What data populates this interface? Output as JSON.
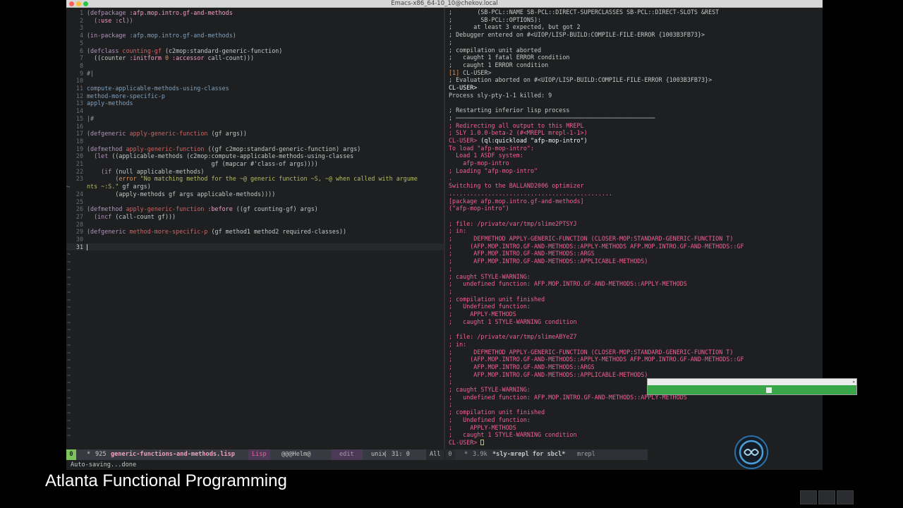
{
  "window": {
    "title": "Emacs-x86_64-10_10@chekov.local"
  },
  "colors": {
    "keyword": "#b294bb",
    "name": "#cc6666",
    "symbol": "#f0a0c0",
    "string": "#b5bd68",
    "function": "#81a2be",
    "paren": "#9da3a8",
    "builtin": "#de935f",
    "comment": "#969896",
    "repl_prompt": "#f5f5f5",
    "repl_output": "#f06292",
    "text": "#c5c8c6"
  },
  "editor": {
    "lines": [
      {
        "n": "1",
        "segs": [
          [
            "(",
            "paren"
          ],
          [
            "defpackage",
            "keyword"
          ],
          [
            " :afp.mop.intro.gf-and-methods",
            "symbol"
          ]
        ]
      },
      {
        "n": "2",
        "segs": [
          [
            "  (",
            "paren"
          ],
          [
            ":use :cl",
            "symbol"
          ],
          [
            "))",
            "paren"
          ]
        ]
      },
      {
        "n": "3",
        "segs": []
      },
      {
        "n": "4",
        "segs": [
          [
            "(",
            "paren"
          ],
          [
            "in-package",
            "keyword"
          ],
          [
            " :afp.mop.intro.gf-and-methods",
            "function"
          ],
          [
            ")",
            "paren"
          ]
        ]
      },
      {
        "n": "5",
        "segs": []
      },
      {
        "n": "6",
        "segs": [
          [
            "(",
            "paren"
          ],
          [
            "defclass",
            "keyword"
          ],
          [
            " counting-gf",
            "name"
          ],
          [
            " (c2mop:standard-generic-function)",
            "text"
          ]
        ]
      },
      {
        "n": "7",
        "segs": [
          [
            "  ((counter ",
            "text"
          ],
          [
            ":initform",
            "symbol"
          ],
          [
            " 0 ",
            "builtin"
          ],
          [
            ":accessor",
            "symbol"
          ],
          [
            " call-count)))",
            "text"
          ]
        ]
      },
      {
        "n": "8",
        "segs": []
      },
      {
        "n": "9",
        "segs": [
          [
            "#|",
            "comment"
          ]
        ]
      },
      {
        "n": "10",
        "segs": []
      },
      {
        "n": "11",
        "segs": [
          [
            "compute-applicable-methods-using-classes",
            "function"
          ]
        ]
      },
      {
        "n": "12",
        "segs": [
          [
            "method-more-specific-p",
            "function"
          ]
        ]
      },
      {
        "n": "13",
        "segs": [
          [
            "apply-methods",
            "function"
          ]
        ]
      },
      {
        "n": "14",
        "segs": []
      },
      {
        "n": "15",
        "segs": [
          [
            "|#",
            "comment"
          ]
        ]
      },
      {
        "n": "16",
        "segs": []
      },
      {
        "n": "17",
        "segs": [
          [
            "(",
            "paren"
          ],
          [
            "defgeneric",
            "keyword"
          ],
          [
            " apply-generic-function",
            "name"
          ],
          [
            " (gf args))",
            "text"
          ]
        ]
      },
      {
        "n": "18",
        "segs": []
      },
      {
        "n": "19",
        "segs": [
          [
            "(",
            "paren"
          ],
          [
            "defmethod",
            "keyword"
          ],
          [
            " apply-generic-function",
            "name"
          ],
          [
            " ((gf c2mop:standard-generic-function) args)",
            "text"
          ]
        ]
      },
      {
        "n": "20",
        "segs": [
          [
            "  (",
            "paren"
          ],
          [
            "let",
            "keyword"
          ],
          [
            " ((applicable-methods (c2mop:compute-applicable-methods-using-classes",
            "text"
          ]
        ]
      },
      {
        "n": "21",
        "segs": [
          [
            "                                   gf (mapcar #'class-of args))))",
            "text"
          ]
        ]
      },
      {
        "n": "22",
        "segs": [
          [
            "    (",
            "paren"
          ],
          [
            "if",
            "keyword"
          ],
          [
            " (null applicable-methods)",
            "text"
          ]
        ]
      },
      {
        "n": "23",
        "segs": [
          [
            "        (",
            "paren"
          ],
          [
            "error",
            "builtin"
          ],
          [
            " \"No matching method for the ~@ generic function ~S, ~@ when called with argume",
            "string"
          ]
        ]
      },
      {
        "n": "",
        "wrap": true,
        "segs": [
          [
            "nts ~:S.\"",
            "string"
          ],
          [
            " gf args)",
            "text"
          ]
        ]
      },
      {
        "n": "24",
        "segs": [
          [
            "        (apply-methods gf args applicable-methods))))",
            "text"
          ]
        ]
      },
      {
        "n": "25",
        "segs": []
      },
      {
        "n": "26",
        "segs": [
          [
            "(",
            "paren"
          ],
          [
            "defmethod",
            "keyword"
          ],
          [
            " apply-generic-function",
            "name"
          ],
          [
            " :before",
            "symbol"
          ],
          [
            " ((gf counting-gf) args)",
            "text"
          ]
        ]
      },
      {
        "n": "27",
        "segs": [
          [
            "  (",
            "paren"
          ],
          [
            "incf",
            "keyword"
          ],
          [
            " (call-count gf)))",
            "text"
          ]
        ]
      },
      {
        "n": "28",
        "segs": []
      },
      {
        "n": "29",
        "segs": [
          [
            "(",
            "paren"
          ],
          [
            "defgeneric",
            "keyword"
          ],
          [
            " method-more-specific-p",
            "name"
          ],
          [
            " (gf method1 method2 required-classes))",
            "text"
          ]
        ]
      },
      {
        "n": "30",
        "segs": []
      },
      {
        "n": "31",
        "segs": [],
        "cursor": true
      }
    ],
    "tilde_count": 25,
    "tilde_char": "~"
  },
  "repl": {
    "lines": [
      {
        "segs": [
          [
            ";       (SB-PCL::NAME SB-PCL::DIRECT-SUPERCLASSES SB-PCL::DIRECT-SLOTS &REST",
            "text"
          ]
        ]
      },
      {
        "segs": [
          [
            ";        SB-PCL::OPTIONS):",
            "text"
          ]
        ]
      },
      {
        "segs": [
          [
            ";      at least 3 expected, but got 2",
            "text"
          ]
        ]
      },
      {
        "segs": [
          [
            "; Debugger entered on #<UIOP/LISP-BUILD:COMPILE-FILE-ERROR {1003B3FB73}>",
            "text"
          ]
        ]
      },
      {
        "segs": [
          [
            ";",
            "text"
          ]
        ]
      },
      {
        "segs": [
          [
            "; compilation unit aborted",
            "text"
          ]
        ]
      },
      {
        "segs": [
          [
            ";   caught 1 fatal ERROR condition",
            "text"
          ]
        ]
      },
      {
        "segs": [
          [
            ";   caught 1 ERROR condition",
            "text"
          ]
        ]
      },
      {
        "segs": [
          [
            "[1] ",
            "builtin"
          ],
          [
            "CL-USER>",
            "text"
          ]
        ]
      },
      {
        "segs": [
          [
            "; Evaluation aborted on #<UIOP/LISP-BUILD:COMPILE-FILE-ERROR {1003B3FB73}>",
            "text"
          ]
        ]
      },
      {
        "segs": [
          [
            "CL-USER>",
            "repl_prompt"
          ]
        ]
      },
      {
        "segs": [
          [
            "Process sly-pty-1-1 killed: 9",
            "text"
          ]
        ]
      },
      {
        "segs": []
      },
      {
        "segs": [
          [
            "; Restarting inferior lisp process",
            "text"
          ]
        ]
      },
      {
        "segs": [
          [
            "; ────────────────────────────────────────────────────────",
            "text"
          ]
        ]
      },
      {
        "segs": [
          [
            "; Redirecting all output to this MREPL",
            "repl_output"
          ]
        ]
      },
      {
        "segs": [
          [
            "; SLY 1.0.0-beta-2 (#<MREPL mrepl-1-1>)",
            "repl_output"
          ]
        ]
      },
      {
        "segs": [
          [
            "CL-USER> ",
            "repl_output"
          ],
          [
            "(ql:quickload \"afp-mop-intro\")",
            "repl_prompt"
          ]
        ]
      },
      {
        "segs": [
          [
            "To load \"afp-mop-intro\":",
            "repl_output"
          ]
        ]
      },
      {
        "segs": [
          [
            "  Load 1 ASDF system:",
            "repl_output"
          ]
        ]
      },
      {
        "segs": [
          [
            "    afp-mop-intro",
            "repl_output"
          ]
        ]
      },
      {
        "segs": [
          [
            "; Loading \"afp-mop-intro\"",
            "repl_output"
          ]
        ]
      },
      {
        "segs": [
          [
            ".",
            "repl_output"
          ]
        ]
      },
      {
        "segs": [
          [
            "Switching to the BALLAND2006 optimizer",
            "repl_output"
          ]
        ]
      },
      {
        "segs": [
          [
            "..............................................",
            "repl_output"
          ]
        ]
      },
      {
        "segs": [
          [
            "[package afp.mop.intro.gf-and-methods]",
            "repl_output"
          ]
        ]
      },
      {
        "segs": [
          [
            "(\"afp-mop-intro\")",
            "repl_output"
          ]
        ]
      },
      {
        "segs": []
      },
      {
        "segs": [
          [
            "; file: /private/var/tmp/slime2PTSYJ",
            "repl_output"
          ]
        ]
      },
      {
        "segs": [
          [
            "; in:",
            "repl_output"
          ]
        ]
      },
      {
        "segs": [
          [
            ";      DEFMETHOD APPLY-GENERIC-FUNCTION (CLOSER-MOP:STANDARD-GENERIC-FUNCTION T)",
            "repl_output"
          ]
        ]
      },
      {
        "segs": [
          [
            ";     (AFP.MOP.INTRO.GF-AND-METHODS::APPLY-METHODS AFP.MOP.INTRO.GF-AND-METHODS::GF",
            "repl_output"
          ]
        ]
      },
      {
        "segs": [
          [
            ";      AFP.MOP.INTRO.GF-AND-METHODS::ARGS",
            "repl_output"
          ]
        ]
      },
      {
        "segs": [
          [
            ";      AFP.MOP.INTRO.GF-AND-METHODS::APPLICABLE-METHODS)",
            "repl_output"
          ]
        ]
      },
      {
        "segs": [
          [
            ";",
            "repl_output"
          ]
        ]
      },
      {
        "segs": [
          [
            "; caught STYLE-WARNING:",
            "repl_output"
          ]
        ]
      },
      {
        "segs": [
          [
            ";   undefined function: AFP.MOP.INTRO.GF-AND-METHODS::APPLY-METHODS",
            "repl_output"
          ]
        ]
      },
      {
        "segs": [
          [
            ";",
            "repl_output"
          ]
        ]
      },
      {
        "segs": [
          [
            "; compilation unit finished",
            "repl_output"
          ]
        ]
      },
      {
        "segs": [
          [
            ";   Undefined function:",
            "repl_output"
          ]
        ]
      },
      {
        "segs": [
          [
            ";     APPLY-METHODS",
            "repl_output"
          ]
        ]
      },
      {
        "segs": [
          [
            ";   caught 1 STYLE-WARNING condition",
            "repl_output"
          ]
        ]
      },
      {
        "segs": []
      },
      {
        "segs": [
          [
            "; file: /private/var/tmp/slimeABYeZ7",
            "repl_output"
          ]
        ]
      },
      {
        "segs": [
          [
            "; in:",
            "repl_output"
          ]
        ]
      },
      {
        "segs": [
          [
            ";      DEFMETHOD APPLY-GENERIC-FUNCTION (CLOSER-MOP:STANDARD-GENERIC-FUNCTION T)",
            "repl_output"
          ]
        ]
      },
      {
        "segs": [
          [
            ";     (AFP.MOP.INTRO.GF-AND-METHODS::APPLY-METHODS AFP.MOP.INTRO.GF-AND-METHODS::GF",
            "repl_output"
          ]
        ]
      },
      {
        "segs": [
          [
            ";      AFP.MOP.INTRO.GF-AND-METHODS::ARGS",
            "repl_output"
          ]
        ]
      },
      {
        "segs": [
          [
            ";      AFP.MOP.INTRO.GF-AND-METHODS::APPLICABLE-METHODS)",
            "repl_output"
          ]
        ]
      },
      {
        "segs": [
          [
            ";",
            "repl_output"
          ]
        ]
      },
      {
        "segs": [
          [
            "; caught STYLE-WARNING:",
            "repl_output"
          ]
        ]
      },
      {
        "segs": [
          [
            ";   undefined function: AFP.MOP.INTRO.GF-AND-METHODS::APPLY-METHODS",
            "repl_output"
          ]
        ]
      },
      {
        "segs": [
          [
            ";",
            "repl_output"
          ]
        ]
      },
      {
        "segs": [
          [
            "; compilation unit finished",
            "repl_output"
          ]
        ]
      },
      {
        "segs": [
          [
            ";   Undefined function:",
            "repl_output"
          ]
        ]
      },
      {
        "segs": [
          [
            ";     APPLY-METHODS",
            "repl_output"
          ]
        ]
      },
      {
        "segs": [
          [
            ";   caught 1 STYLE-WARNING condition",
            "repl_output"
          ]
        ]
      },
      {
        "segs": [
          [
            "CL-USER> ",
            "repl_output"
          ]
        ],
        "cursor": true
      }
    ]
  },
  "modeline_left": {
    "indicator": "0",
    "buffer_star": "*",
    "size": "925",
    "buffer_name": "generic-functions-and-methods.lisp",
    "major_mode": "Lisp",
    "minor_modes": "@@@Helm@",
    "evil_state": "edit",
    "encoding": "unix",
    "position": "31: 0",
    "scroll": "All"
  },
  "modeline_right": {
    "indicator": "0",
    "buffer_star": "*",
    "size": "3.9k",
    "buffer_name": "*sly-mrepl for sbcl*",
    "major_mode": "mrepl"
  },
  "echo_area": {
    "text": "Auto-saving...done"
  },
  "caption": {
    "text": "Atlanta Functional Programming"
  }
}
